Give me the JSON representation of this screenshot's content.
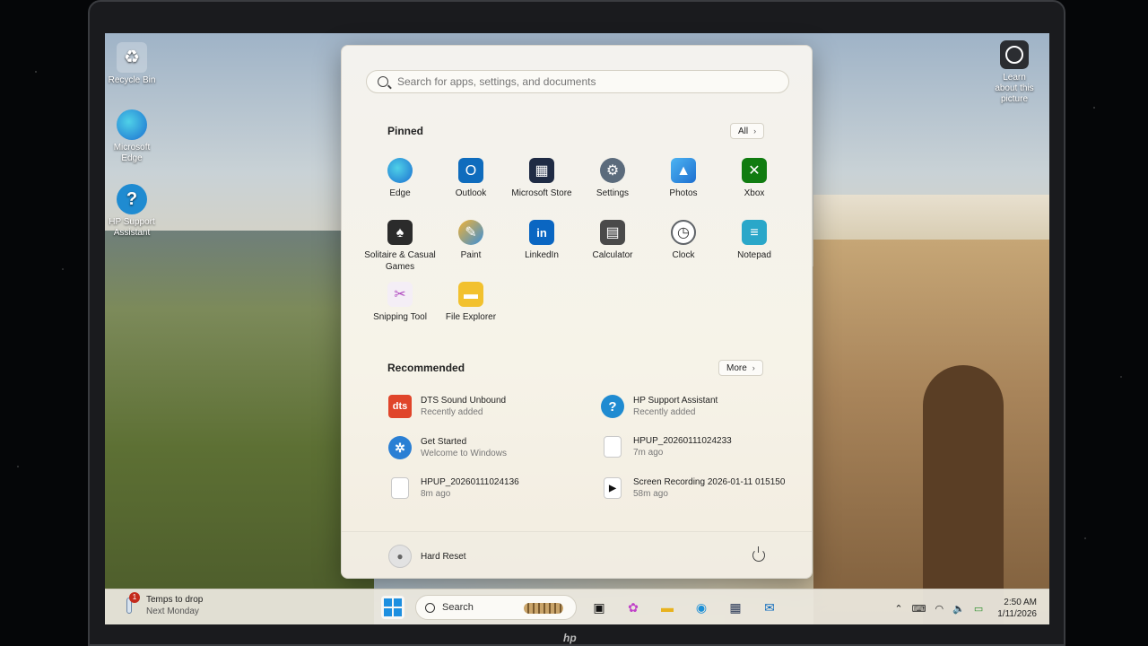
{
  "desktop": {
    "icons": [
      {
        "label": "Recycle Bin"
      },
      {
        "label": "Microsoft Edge"
      },
      {
        "label": "HP Support Assistant"
      }
    ],
    "learn_label": "Learn about this picture"
  },
  "start_menu": {
    "search_placeholder": "Search for apps, settings, and documents",
    "pinned_title": "Pinned",
    "all_button": "All",
    "pinned": [
      {
        "label": "Edge",
        "icon": "edge-icon",
        "color": "#1b8fd6"
      },
      {
        "label": "Outlook",
        "icon": "outlook-icon",
        "color": "#0f6cbd"
      },
      {
        "label": "Microsoft Store",
        "icon": "store-icon",
        "color": "#1f2b44"
      },
      {
        "label": "Settings",
        "icon": "gear-icon",
        "color": "#5b6b7c"
      },
      {
        "label": "Photos",
        "icon": "photos-icon",
        "color": "#2d8ce8"
      },
      {
        "label": "Xbox",
        "icon": "xbox-icon",
        "color": "#107c10"
      },
      {
        "label": "Solitaire & Casual Games",
        "icon": "cards-icon",
        "color": "#2b2b2b"
      },
      {
        "label": "Paint",
        "icon": "paint-icon",
        "color": "#3a8fd9"
      },
      {
        "label": "LinkedIn",
        "icon": "linkedin-icon",
        "color": "#0a66c2"
      },
      {
        "label": "Calculator",
        "icon": "calculator-icon",
        "color": "#4a4a4a"
      },
      {
        "label": "Clock",
        "icon": "clock-icon",
        "color": "#5f6368"
      },
      {
        "label": "Notepad",
        "icon": "notepad-icon",
        "color": "#2aa7c9"
      },
      {
        "label": "Snipping Tool",
        "icon": "scissors-icon",
        "color": "#b04ac0"
      },
      {
        "label": "File Explorer",
        "icon": "folder-icon",
        "color": "#f2c12e"
      }
    ],
    "recommended_title": "Recommended",
    "more_button": "More",
    "recommended": [
      {
        "title": "DTS Sound Unbound",
        "sub": "Recently added",
        "icon": "dts-icon",
        "color": "#e0452a"
      },
      {
        "title": "HP Support Assistant",
        "sub": "Recently added",
        "icon": "question-icon",
        "color": "#1f8bd1"
      },
      {
        "title": "Get Started",
        "sub": "Welcome to Windows",
        "icon": "getstarted-icon",
        "color": "#2a7fd4"
      },
      {
        "title": "HPUP_20260111024233",
        "sub": "7m ago",
        "icon": "document-icon",
        "color": "#ffffff"
      },
      {
        "title": "HPUP_20260111024136",
        "sub": "8m ago",
        "icon": "document-icon",
        "color": "#ffffff"
      },
      {
        "title": "Screen Recording 2026-01-11 015150",
        "sub": "58m ago",
        "icon": "video-file-icon",
        "color": "#ffffff"
      }
    ],
    "user_name": "Hard Reset"
  },
  "taskbar": {
    "weather_title": "Temps to drop",
    "weather_sub": "Next Monday",
    "weather_badge": "1",
    "search_label": "Search",
    "time": "2:50 AM",
    "date": "1/11/2026"
  },
  "brand": "hp"
}
